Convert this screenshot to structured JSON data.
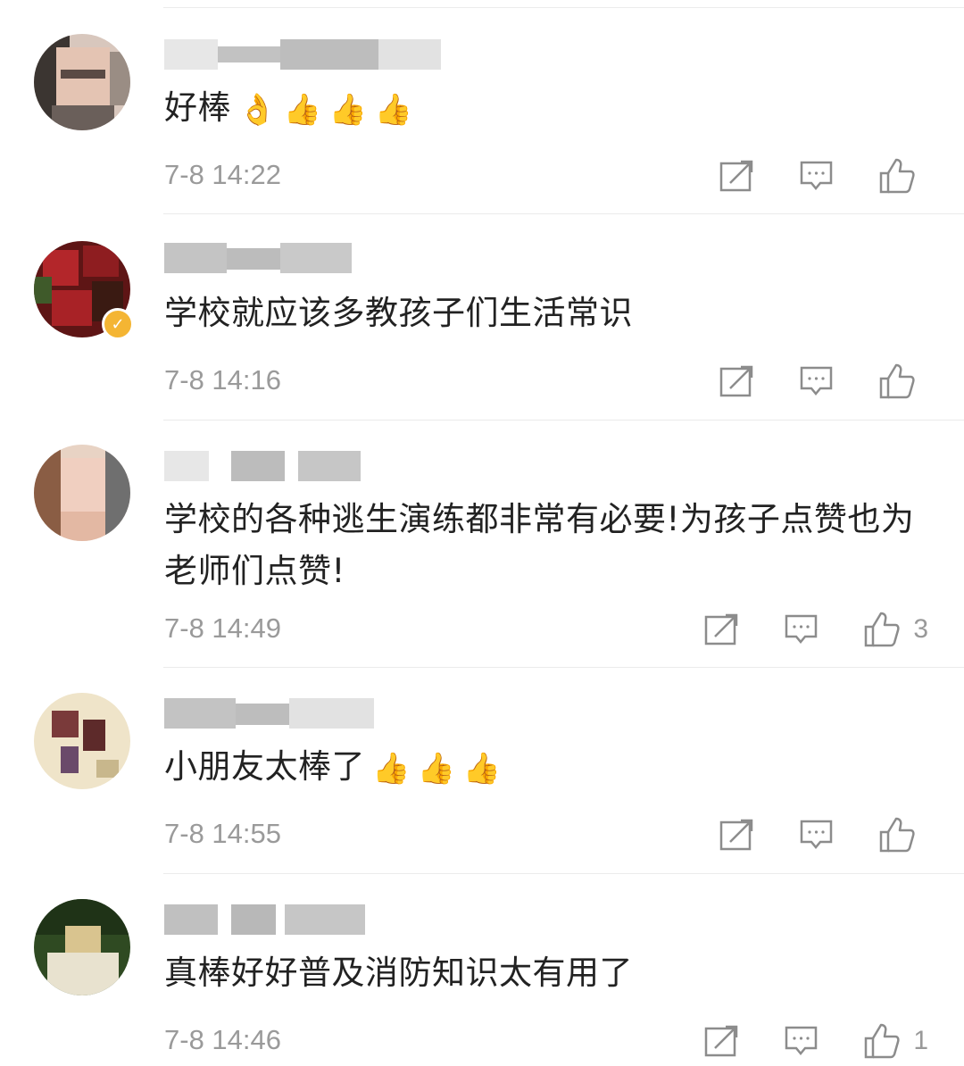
{
  "comments": [
    {
      "text": "好棒",
      "emojis": [
        "👌",
        "👍",
        "👍",
        "👍"
      ],
      "time": "7-8 14:22",
      "likes": ""
    },
    {
      "text": "学校就应该多教孩子们生活常识",
      "emojis": [],
      "time": "7-8 14:16",
      "likes": ""
    },
    {
      "text": "学校的各种逃生演练都非常有必要!为孩子点赞也为老师们点赞!",
      "emojis": [],
      "time": "7-8 14:49",
      "likes": "3"
    },
    {
      "text": "小朋友太棒了",
      "emojis": [
        "👍",
        "👍",
        "👍"
      ],
      "time": "7-8 14:55",
      "likes": ""
    },
    {
      "text": "真棒好好普及消防知识太有用了",
      "emojis": [],
      "time": "7-8 14:46",
      "likes": "1"
    }
  ],
  "icons": {
    "share": "share-icon",
    "reply": "comment-icon",
    "like": "thumbs-up-icon",
    "verified": "verified-badge-icon"
  },
  "colors": {
    "text": "#222222",
    "meta": "#9a9a9a",
    "icon": "#8c8c8c",
    "verified": "#f4b533"
  }
}
